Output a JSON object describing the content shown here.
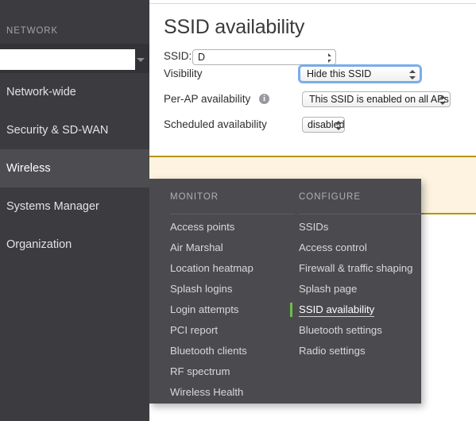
{
  "sidebar": {
    "section_label": "NETWORK",
    "network_picker": {
      "value": "",
      "placeholder": "",
      "arrow_icon": "caret-down-icon"
    },
    "items": [
      {
        "label": "Network-wide",
        "active": false
      },
      {
        "label": "Security & SD-WAN",
        "active": false
      },
      {
        "label": "Wireless",
        "active": true
      },
      {
        "label": "Systems Manager",
        "active": false
      },
      {
        "label": "Organization",
        "active": false
      }
    ]
  },
  "main": {
    "page_title": "SSID availability",
    "rows": {
      "ssid": {
        "label": "SSID:",
        "value": "D",
        "control": "select"
      },
      "visibility": {
        "label": "Visibility",
        "value": "Hide this SSID",
        "control": "select",
        "focused": true
      },
      "per_ap": {
        "label": "Per-AP availability",
        "info_icon": "info-icon",
        "value": "This SSID is enabled on all APs",
        "control": "select"
      },
      "scheduled": {
        "label": "Scheduled availability",
        "value": "disabled",
        "control": "select"
      }
    }
  },
  "popup": {
    "columns": [
      {
        "title": "MONITOR",
        "items": [
          {
            "label": "Access points",
            "selected": false
          },
          {
            "label": "Air Marshal",
            "selected": false
          },
          {
            "label": "Location heatmap",
            "selected": false
          },
          {
            "label": "Splash logins",
            "selected": false
          },
          {
            "label": "Login attempts",
            "selected": false
          },
          {
            "label": "PCI report",
            "selected": false
          },
          {
            "label": "Bluetooth clients",
            "selected": false
          },
          {
            "label": "RF spectrum",
            "selected": false
          },
          {
            "label": "Wireless Health",
            "selected": false
          }
        ]
      },
      {
        "title": "CONFIGURE",
        "items": [
          {
            "label": "SSIDs",
            "selected": false
          },
          {
            "label": "Access control",
            "selected": false
          },
          {
            "label": "Firewall & traffic shaping",
            "selected": false
          },
          {
            "label": "Splash page",
            "selected": false
          },
          {
            "label": "SSID availability",
            "selected": true
          },
          {
            "label": "Bluetooth settings",
            "selected": false
          },
          {
            "label": "Radio settings",
            "selected": false
          }
        ]
      }
    ]
  },
  "colors": {
    "sidebar_bg": "#3c3c40",
    "sidebar_active": "#4c4c51",
    "popup_bg": "#4b4b4f",
    "accent_green": "#6cbf4b",
    "banner_bg": "#fdf3e0",
    "banner_border": "#b8950c",
    "focus_ring": "#79a7e8"
  }
}
